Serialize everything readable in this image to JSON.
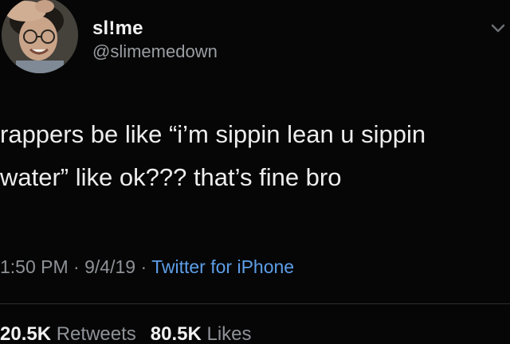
{
  "user": {
    "display_name": "sl!me",
    "handle": "@slimemedown"
  },
  "tweet": {
    "lines": [
      "rappers be like “i’m sippin lean u sippin",
      "water” like ok??? that’s fine bro"
    ]
  },
  "meta": {
    "time": "1:50 PM",
    "separator": "·",
    "date": "9/4/19",
    "source": "Twitter for iPhone"
  },
  "stats": {
    "retweets_count": "20.5K",
    "retweets_label": "Retweets",
    "likes_count": "80.5K",
    "likes_label": "Likes"
  },
  "colors": {
    "background": "#060606",
    "text": "#ededed",
    "muted": "#8e9297",
    "link": "#5d9ee8"
  },
  "icons": {
    "menu": "chevron-down-icon"
  }
}
